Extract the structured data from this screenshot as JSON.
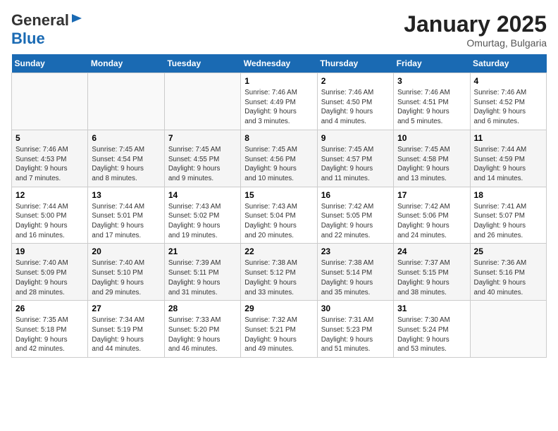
{
  "header": {
    "logo_line1": "General",
    "logo_line2": "Blue",
    "month": "January 2025",
    "location": "Omurtag, Bulgaria"
  },
  "weekdays": [
    "Sunday",
    "Monday",
    "Tuesday",
    "Wednesday",
    "Thursday",
    "Friday",
    "Saturday"
  ],
  "weeks": [
    [
      {
        "day": "",
        "text": ""
      },
      {
        "day": "",
        "text": ""
      },
      {
        "day": "",
        "text": ""
      },
      {
        "day": "1",
        "text": "Sunrise: 7:46 AM\nSunset: 4:49 PM\nDaylight: 9 hours and 3 minutes."
      },
      {
        "day": "2",
        "text": "Sunrise: 7:46 AM\nSunset: 4:50 PM\nDaylight: 9 hours and 4 minutes."
      },
      {
        "day": "3",
        "text": "Sunrise: 7:46 AM\nSunset: 4:51 PM\nDaylight: 9 hours and 5 minutes."
      },
      {
        "day": "4",
        "text": "Sunrise: 7:46 AM\nSunset: 4:52 PM\nDaylight: 9 hours and 6 minutes."
      }
    ],
    [
      {
        "day": "5",
        "text": "Sunrise: 7:46 AM\nSunset: 4:53 PM\nDaylight: 9 hours and 7 minutes."
      },
      {
        "day": "6",
        "text": "Sunrise: 7:45 AM\nSunset: 4:54 PM\nDaylight: 9 hours and 8 minutes."
      },
      {
        "day": "7",
        "text": "Sunrise: 7:45 AM\nSunset: 4:55 PM\nDaylight: 9 hours and 9 minutes."
      },
      {
        "day": "8",
        "text": "Sunrise: 7:45 AM\nSunset: 4:56 PM\nDaylight: 9 hours and 10 minutes."
      },
      {
        "day": "9",
        "text": "Sunrise: 7:45 AM\nSunset: 4:57 PM\nDaylight: 9 hours and 11 minutes."
      },
      {
        "day": "10",
        "text": "Sunrise: 7:45 AM\nSunset: 4:58 PM\nDaylight: 9 hours and 13 minutes."
      },
      {
        "day": "11",
        "text": "Sunrise: 7:44 AM\nSunset: 4:59 PM\nDaylight: 9 hours and 14 minutes."
      }
    ],
    [
      {
        "day": "12",
        "text": "Sunrise: 7:44 AM\nSunset: 5:00 PM\nDaylight: 9 hours and 16 minutes."
      },
      {
        "day": "13",
        "text": "Sunrise: 7:44 AM\nSunset: 5:01 PM\nDaylight: 9 hours and 17 minutes."
      },
      {
        "day": "14",
        "text": "Sunrise: 7:43 AM\nSunset: 5:02 PM\nDaylight: 9 hours and 19 minutes."
      },
      {
        "day": "15",
        "text": "Sunrise: 7:43 AM\nSunset: 5:04 PM\nDaylight: 9 hours and 20 minutes."
      },
      {
        "day": "16",
        "text": "Sunrise: 7:42 AM\nSunset: 5:05 PM\nDaylight: 9 hours and 22 minutes."
      },
      {
        "day": "17",
        "text": "Sunrise: 7:42 AM\nSunset: 5:06 PM\nDaylight: 9 hours and 24 minutes."
      },
      {
        "day": "18",
        "text": "Sunrise: 7:41 AM\nSunset: 5:07 PM\nDaylight: 9 hours and 26 minutes."
      }
    ],
    [
      {
        "day": "19",
        "text": "Sunrise: 7:40 AM\nSunset: 5:09 PM\nDaylight: 9 hours and 28 minutes."
      },
      {
        "day": "20",
        "text": "Sunrise: 7:40 AM\nSunset: 5:10 PM\nDaylight: 9 hours and 29 minutes."
      },
      {
        "day": "21",
        "text": "Sunrise: 7:39 AM\nSunset: 5:11 PM\nDaylight: 9 hours and 31 minutes."
      },
      {
        "day": "22",
        "text": "Sunrise: 7:38 AM\nSunset: 5:12 PM\nDaylight: 9 hours and 33 minutes."
      },
      {
        "day": "23",
        "text": "Sunrise: 7:38 AM\nSunset: 5:14 PM\nDaylight: 9 hours and 35 minutes."
      },
      {
        "day": "24",
        "text": "Sunrise: 7:37 AM\nSunset: 5:15 PM\nDaylight: 9 hours and 38 minutes."
      },
      {
        "day": "25",
        "text": "Sunrise: 7:36 AM\nSunset: 5:16 PM\nDaylight: 9 hours and 40 minutes."
      }
    ],
    [
      {
        "day": "26",
        "text": "Sunrise: 7:35 AM\nSunset: 5:18 PM\nDaylight: 9 hours and 42 minutes."
      },
      {
        "day": "27",
        "text": "Sunrise: 7:34 AM\nSunset: 5:19 PM\nDaylight: 9 hours and 44 minutes."
      },
      {
        "day": "28",
        "text": "Sunrise: 7:33 AM\nSunset: 5:20 PM\nDaylight: 9 hours and 46 minutes."
      },
      {
        "day": "29",
        "text": "Sunrise: 7:32 AM\nSunset: 5:21 PM\nDaylight: 9 hours and 49 minutes."
      },
      {
        "day": "30",
        "text": "Sunrise: 7:31 AM\nSunset: 5:23 PM\nDaylight: 9 hours and 51 minutes."
      },
      {
        "day": "31",
        "text": "Sunrise: 7:30 AM\nSunset: 5:24 PM\nDaylight: 9 hours and 53 minutes."
      },
      {
        "day": "",
        "text": ""
      }
    ]
  ]
}
